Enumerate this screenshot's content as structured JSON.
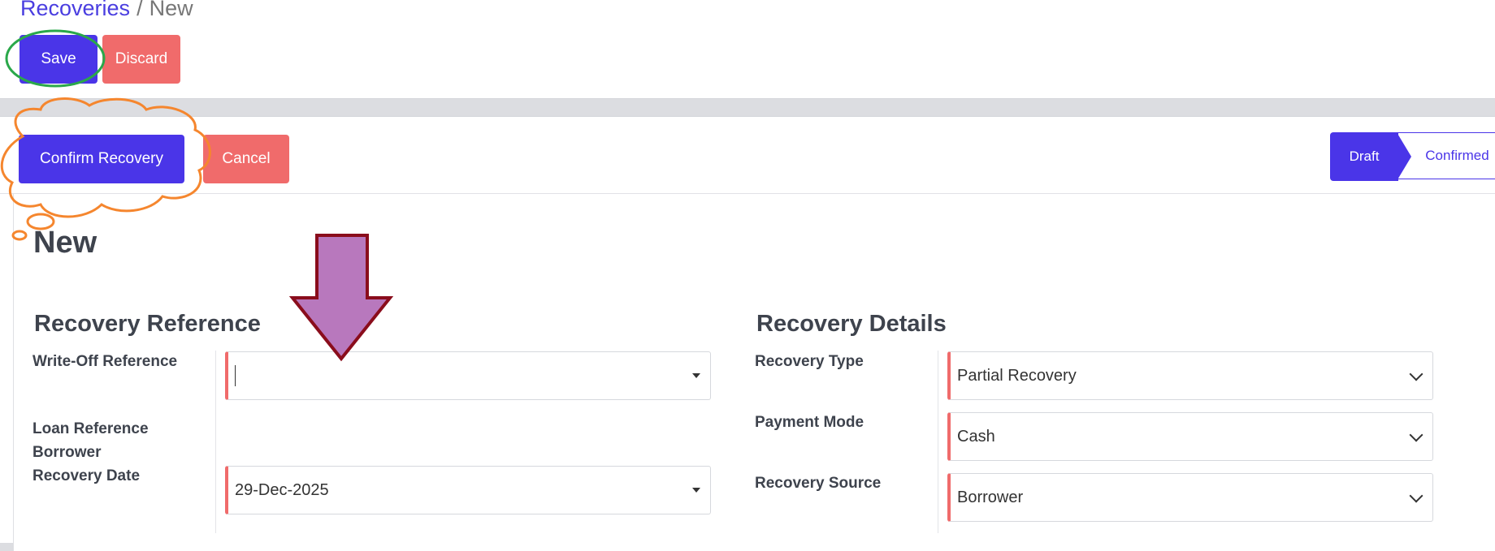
{
  "breadcrumb": {
    "parent": "Recoveries",
    "separator": "/",
    "current": "New"
  },
  "toolbar": {
    "save_label": "Save",
    "discard_label": "Discard"
  },
  "actions": {
    "confirm_label": "Confirm Recovery",
    "cancel_label": "Cancel"
  },
  "status": {
    "steps": [
      "Draft",
      "Confirmed"
    ],
    "active": "Draft"
  },
  "record": {
    "title": "New"
  },
  "sections": {
    "reference": {
      "title": "Recovery Reference",
      "labels": {
        "write_off": "Write-Off Reference",
        "loan": "Loan Reference",
        "borrower": "Borrower",
        "date": "Recovery Date"
      },
      "values": {
        "write_off": "",
        "date": "29-Dec-2025"
      }
    },
    "details": {
      "title": "Recovery Details",
      "labels": {
        "type": "Recovery Type",
        "payment": "Payment Mode",
        "source": "Recovery Source"
      },
      "values": {
        "type": "Partial Recovery",
        "payment": "Cash",
        "source": "Borrower"
      }
    }
  },
  "colors": {
    "primary": "#4a35e8",
    "danger": "#f06b6b",
    "annotation_green": "#2aa84a",
    "annotation_orange": "#f5862e",
    "annotation_arrow_fill": "#b878bd",
    "annotation_arrow_stroke": "#8a0d1c"
  }
}
